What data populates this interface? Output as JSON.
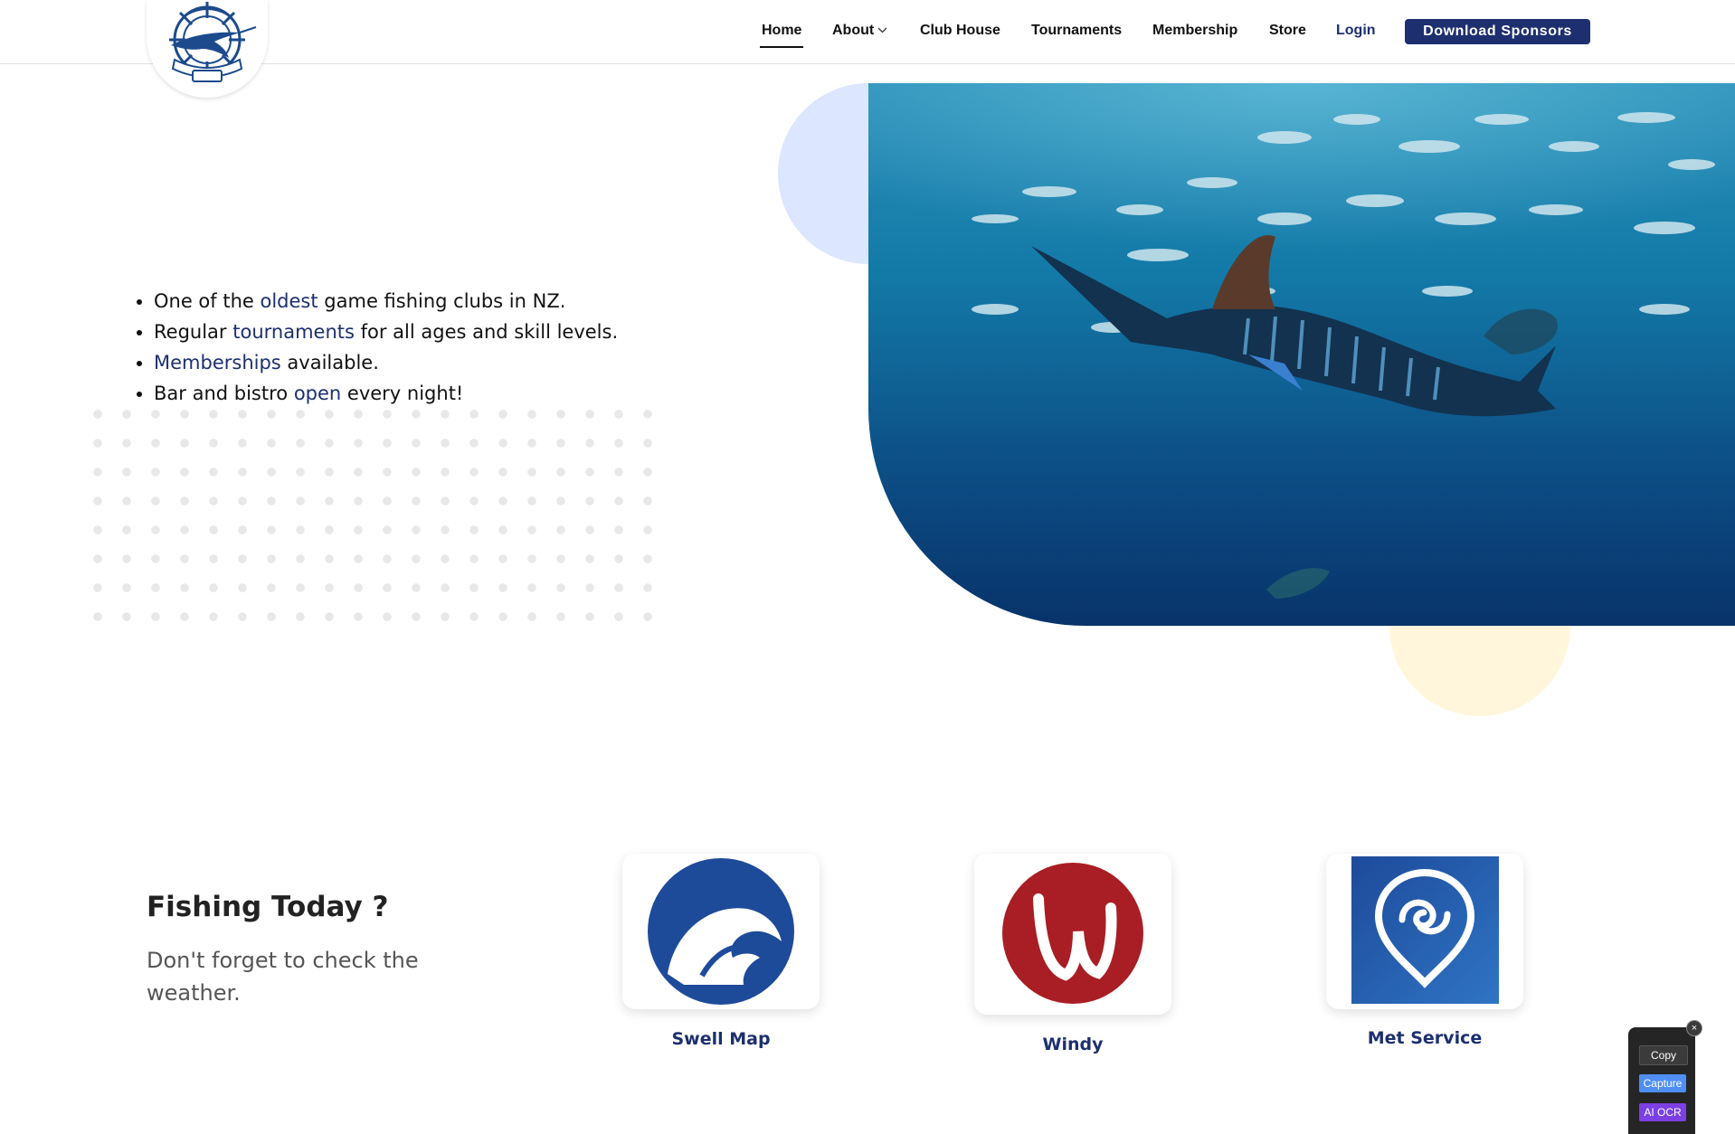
{
  "header": {
    "logo_alt": "Mercury Bay New Zealand Game Fishing Club",
    "nav": {
      "home": "Home",
      "about": "About",
      "club_house": "Club House",
      "tournaments": "Tournaments",
      "membership": "Membership",
      "store": "Store",
      "login": "Login"
    },
    "sponsor_button": "Download Sponsors"
  },
  "hero": {
    "bullets": [
      {
        "pre": "One of the ",
        "link": "oldest",
        "post": " game fishing clubs in NZ."
      },
      {
        "pre": "Regular ",
        "link": "tournaments",
        "post": " for all ages and skill levels."
      },
      {
        "pre": "",
        "link": "Memberships",
        "post": " available."
      },
      {
        "pre": "Bar and bistro ",
        "link": "open",
        "post": " every night!"
      }
    ],
    "image_alt": "Marlin swimming through a school of fish"
  },
  "weather": {
    "title": "Fishing Today ?",
    "subtitle": "Don't forget to check the weather.",
    "cards": [
      {
        "label": "Swell Map",
        "icon": "wave-icon",
        "color": "#1e4a9a"
      },
      {
        "label": "Windy",
        "icon": "windy-icon",
        "color": "#a81e24"
      },
      {
        "label": "Met Service",
        "icon": "location-swirl-icon",
        "color": "#2a62b8"
      }
    ]
  },
  "ocr_widget": {
    "copy": "Copy",
    "capture": "Capture",
    "ai_ocr": "AI OCR",
    "close": "×"
  },
  "colors": {
    "brand": "#1d2f6f",
    "accent_blue_blob": "#dce6ff",
    "accent_yellow_blob": "#fff6dc"
  }
}
